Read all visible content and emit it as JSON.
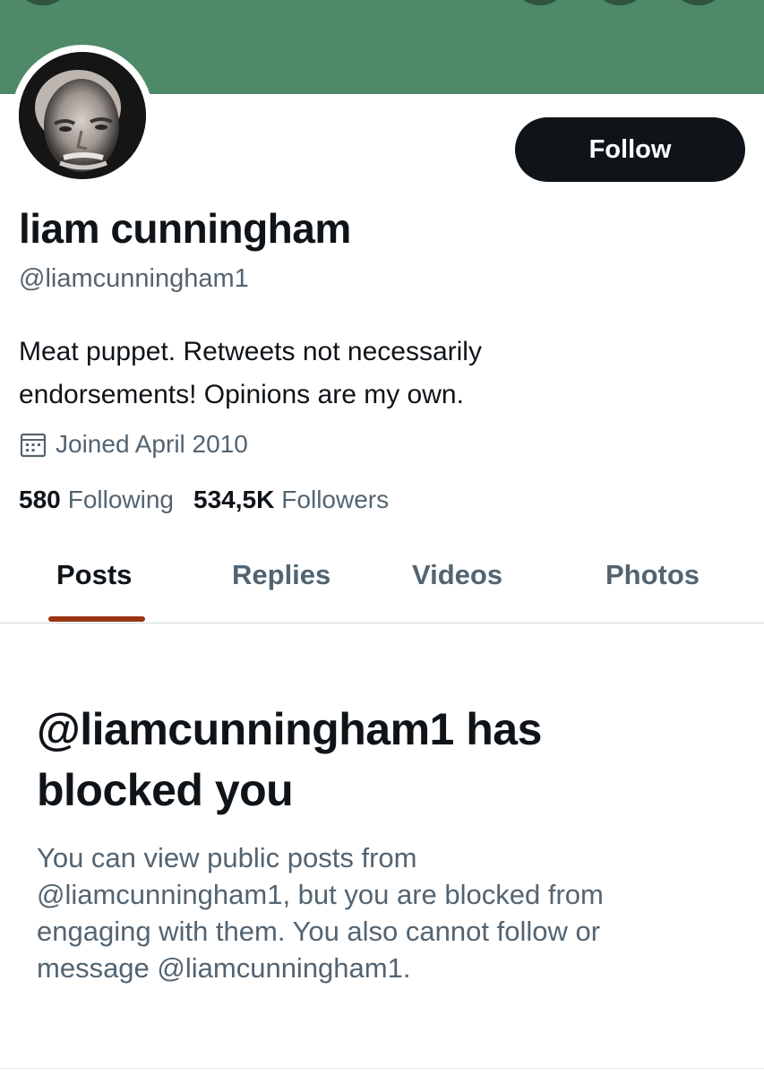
{
  "profile": {
    "display_name": "liam cunningham",
    "handle": "@liamcunningham1",
    "bio_lines": [
      "Meat puppet. Retweets not necessarily",
      "endorsements! Opinions are my own."
    ],
    "joined": "Joined April 2010",
    "following_count": "580",
    "following_label": "Following",
    "followers_count": "534,5K",
    "followers_label": "Followers"
  },
  "actions": {
    "follow_label": "Follow"
  },
  "tabs": [
    {
      "label": "Posts",
      "active": true
    },
    {
      "label": "Replies",
      "active": false
    },
    {
      "label": "Videos",
      "active": false
    },
    {
      "label": "Photos",
      "active": false
    }
  ],
  "blocked": {
    "title_lines": [
      "@liamcunningham1 has",
      "blocked you"
    ],
    "body_lines": [
      "You can view public posts from",
      "@liamcunningham1, but you are blocked from",
      "engaging with them. You also cannot follow or",
      "message @liamcunningham1."
    ]
  },
  "icons": {
    "calendar": "calendar-icon"
  },
  "colors": {
    "banner": "#4f8a68",
    "follow_button": "#0f1419",
    "secondary_text": "#536471",
    "tab_indicator": "#9a3412"
  }
}
